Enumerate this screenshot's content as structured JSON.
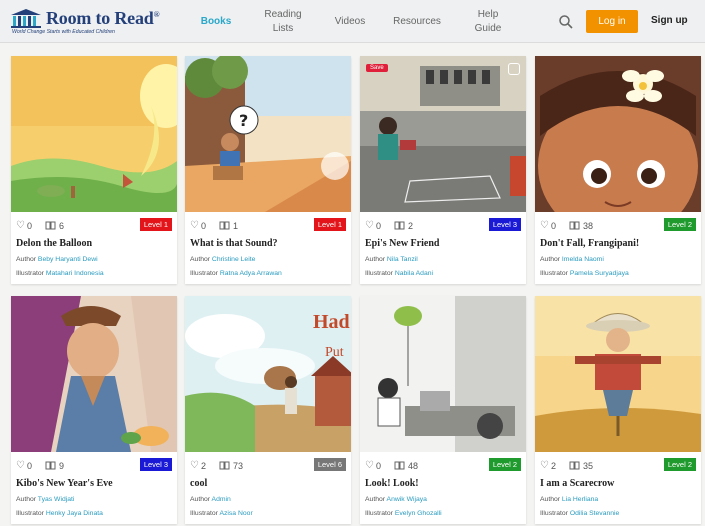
{
  "header": {
    "logo_title": "Room to Read",
    "logo_tag": "World Change Starts with Educated Children",
    "nav": [
      {
        "label": "Books",
        "active": true
      },
      {
        "label": "Reading Lists",
        "active": false
      },
      {
        "label": "Videos",
        "active": false
      },
      {
        "label": "Resources",
        "active": false
      },
      {
        "label": "Help Guide",
        "active": false
      }
    ],
    "search_icon": "search-icon",
    "login_label": "Log in",
    "signup_label": "Sign up"
  },
  "colors": {
    "brand": "#24407a",
    "accent": "#2aa7c9",
    "login": "#f39200",
    "level_red": "#e3151a",
    "level_blue": "#1a1ad6",
    "level_green": "#1f9a2c",
    "level_grey": "#777777"
  },
  "labels": {
    "author": "Author",
    "illustrator": "Illustrator"
  },
  "books": [
    {
      "likes": "0",
      "pages": "6",
      "level": "Level 1",
      "level_color": "#e3151a",
      "title": "Delon the Balloon",
      "author": "Beby Haryanti Dewi",
      "illustrator": "Matahari Indonesia"
    },
    {
      "likes": "0",
      "pages": "1",
      "level": "Level 1",
      "level_color": "#e3151a",
      "title": "What is that Sound?",
      "author": "Christine Leite",
      "illustrator": "Ratna Adya Arrawan"
    },
    {
      "likes": "0",
      "pages": "2",
      "level": "Level 3",
      "level_color": "#1a1ad6",
      "title": "Epi's New Friend",
      "author": "Nila Tanzil",
      "illustrator": "Nabila Adani",
      "save": "Save"
    },
    {
      "likes": "0",
      "pages": "38",
      "level": "Level 2",
      "level_color": "#1f9a2c",
      "title": "Don't Fall, Frangipani!",
      "author": "Imelda Naomi",
      "illustrator": "Pamela Suryadjaya"
    },
    {
      "likes": "0",
      "pages": "9",
      "level": "Level 3",
      "level_color": "#1a1ad6",
      "title": "Kibo's New Year's Eve",
      "author": "Tyas Widjati",
      "illustrator": "Henky Jaya Dinata"
    },
    {
      "likes": "2",
      "pages": "73",
      "level": "Level 6",
      "level_color": "#777777",
      "title": "cool",
      "author": "Admin",
      "illustrator": "Azisa Noor"
    },
    {
      "likes": "0",
      "pages": "48",
      "level": "Level 2",
      "level_color": "#1f9a2c",
      "title": "Look! Look!",
      "author": "Anwik Wijaya",
      "illustrator": "Evelyn Ghozalli"
    },
    {
      "likes": "2",
      "pages": "35",
      "level": "Level 2",
      "level_color": "#1f9a2c",
      "title": "I am a Scarecrow",
      "author": "Lia Herliana",
      "illustrator": "Odilia Stevannie"
    }
  ]
}
